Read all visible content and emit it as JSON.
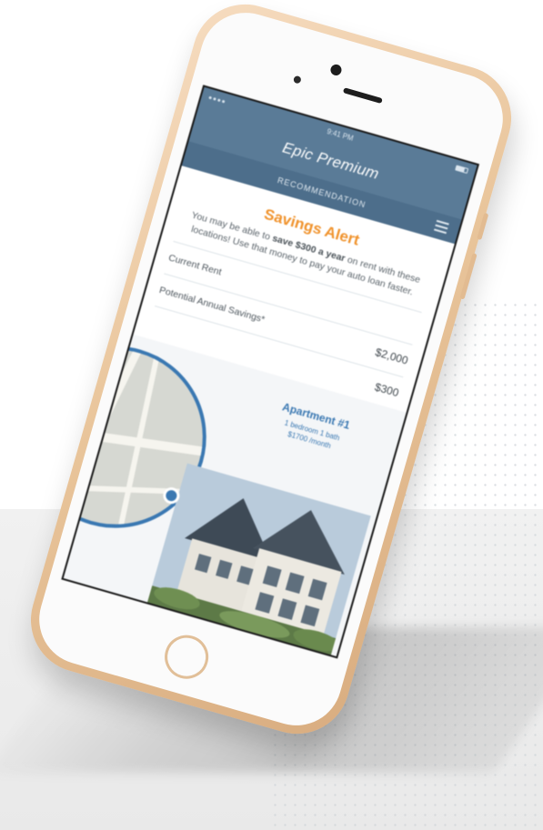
{
  "status_bar": {
    "time": "9:41 PM"
  },
  "header": {
    "title": "Epic Premium",
    "subtitle": "RECOMMENDATION"
  },
  "alert": {
    "title": "Savings Alert",
    "text_before": "You may be able to ",
    "highlight": "save $300 a year",
    "text_after": " on rent with these locations! Use that money to pay your auto loan faster."
  },
  "rows": [
    {
      "label": "Current Rent",
      "value": ""
    },
    {
      "label": "Potential Annual Savings*",
      "value": "$2,000"
    },
    {
      "label": "",
      "value": "$300"
    }
  ],
  "apartment": {
    "title": "Apartment #1",
    "line1": "1 bedroom 1 bath",
    "line2": "$1700 /month"
  },
  "colors": {
    "header_blue": "#5a7b97",
    "accent_orange": "#f0922b",
    "apartment_blue": "#3a78b2"
  }
}
